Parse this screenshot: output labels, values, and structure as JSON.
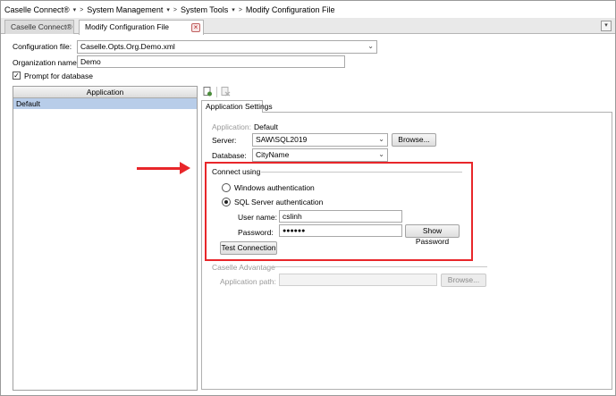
{
  "breadcrumb": {
    "items": [
      "Caselle Connect®",
      "System Management",
      "System Tools",
      "Modify Configuration File"
    ]
  },
  "tabs": {
    "inactive": "Caselle Connect®",
    "active": "Modify Configuration File",
    "close_glyph": "×",
    "menu_glyph": "▾"
  },
  "form": {
    "config_file_label": "Configuration file:",
    "config_file_value": "Caselle.Opts.Org.Demo.xml",
    "org_name_label": "Organization name:",
    "org_name_value": "Demo",
    "prompt_label": "Prompt for database",
    "prompt_checked": true
  },
  "left_panel": {
    "header": "Application",
    "rows": [
      "Default"
    ]
  },
  "settings": {
    "tab_label": "Application Settings",
    "application_label": "Application:",
    "application_value": "Default",
    "server_label": "Server:",
    "server_value": "SAW\\SQL2019",
    "browse_label": "Browse...",
    "database_label": "Database:",
    "database_value": "CityName",
    "connect_using_label": "Connect using",
    "windows_auth_label": "Windows authentication",
    "sql_auth_label": "SQL Server authentication",
    "selected_auth": "sql",
    "username_label": "User name:",
    "username_value": "cslinh",
    "password_label": "Password:",
    "password_value": "●●●●●●",
    "show_password_label": "Show Password",
    "test_connection_label": "Test Connection",
    "caselle_advantage_label": "Caselle Advantage",
    "app_path_label": "Application path:",
    "app_path_value": "",
    "browse2_label": "Browse..."
  },
  "annotation": {
    "color": "#e8262a"
  }
}
